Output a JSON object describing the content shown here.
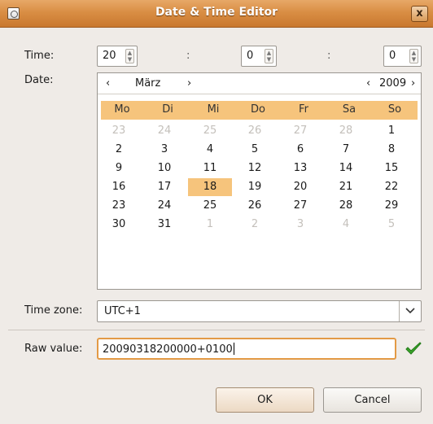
{
  "window": {
    "title": "Date & Time Editor",
    "close_glyph": "x"
  },
  "time": {
    "label": "Time:",
    "hour": "20",
    "minute": "0",
    "second": "0",
    "separator": ":"
  },
  "date": {
    "label": "Date:",
    "month": "März",
    "year": "2009",
    "prev_month": "‹",
    "next_month": "›",
    "prev_year": "‹",
    "next_year": "›",
    "weekdays": [
      "Mo",
      "Di",
      "Mi",
      "Do",
      "Fr",
      "Sa",
      "So"
    ],
    "weeks": [
      [
        {
          "d": "23",
          "o": 1
        },
        {
          "d": "24",
          "o": 1
        },
        {
          "d": "25",
          "o": 1
        },
        {
          "d": "26",
          "o": 1
        },
        {
          "d": "27",
          "o": 1
        },
        {
          "d": "28",
          "o": 1
        },
        {
          "d": "1",
          "o": 0
        }
      ],
      [
        {
          "d": "2",
          "o": 0
        },
        {
          "d": "3",
          "o": 0
        },
        {
          "d": "4",
          "o": 0
        },
        {
          "d": "5",
          "o": 0
        },
        {
          "d": "6",
          "o": 0
        },
        {
          "d": "7",
          "o": 0
        },
        {
          "d": "8",
          "o": 0
        }
      ],
      [
        {
          "d": "9",
          "o": 0
        },
        {
          "d": "10",
          "o": 0
        },
        {
          "d": "11",
          "o": 0
        },
        {
          "d": "12",
          "o": 0
        },
        {
          "d": "13",
          "o": 0
        },
        {
          "d": "14",
          "o": 0
        },
        {
          "d": "15",
          "o": 0
        }
      ],
      [
        {
          "d": "16",
          "o": 0
        },
        {
          "d": "17",
          "o": 0
        },
        {
          "d": "18",
          "o": 0,
          "sel": 1
        },
        {
          "d": "19",
          "o": 0
        },
        {
          "d": "20",
          "o": 0
        },
        {
          "d": "21",
          "o": 0
        },
        {
          "d": "22",
          "o": 0
        }
      ],
      [
        {
          "d": "23",
          "o": 0
        },
        {
          "d": "24",
          "o": 0
        },
        {
          "d": "25",
          "o": 0
        },
        {
          "d": "26",
          "o": 0
        },
        {
          "d": "27",
          "o": 0
        },
        {
          "d": "28",
          "o": 0
        },
        {
          "d": "29",
          "o": 0
        }
      ],
      [
        {
          "d": "30",
          "o": 0
        },
        {
          "d": "31",
          "o": 0
        },
        {
          "d": "1",
          "o": 1
        },
        {
          "d": "2",
          "o": 1
        },
        {
          "d": "3",
          "o": 1
        },
        {
          "d": "4",
          "o": 1
        },
        {
          "d": "5",
          "o": 1
        }
      ]
    ]
  },
  "timezone": {
    "label": "Time zone:",
    "value": "UTC+1",
    "dropdown_icon": "chevron-down-icon"
  },
  "raw": {
    "label": "Raw value:",
    "value": "20090318200000+0100",
    "valid_icon": "checkmark-icon",
    "valid_color": "#3aa52a"
  },
  "buttons": {
    "ok": "OK",
    "cancel": "Cancel"
  },
  "colors": {
    "titlebar": "#d98e44",
    "accent": "#f6c47c",
    "focus": "#e39a45"
  }
}
